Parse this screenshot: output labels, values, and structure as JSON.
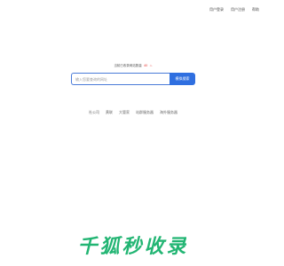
{
  "top_nav": {
    "items": [
      {
        "label": "用户登录"
      },
      {
        "label": "用户注册"
      },
      {
        "label": "帮助"
      }
    ]
  },
  "notice": {
    "text": "当前已收录网站数量",
    "count": "40",
    "icon": "fire-icon"
  },
  "search": {
    "placeholder": "输入您要查询的网址",
    "button_label": "模拟搜索"
  },
  "quick_links": [
    {
      "label": "社公司"
    },
    {
      "label": "黄联"
    },
    {
      "label": "大管家"
    },
    {
      "label": "站群服务器"
    },
    {
      "label": "海外服务器"
    }
  ],
  "logo": {
    "text": "千狐秒收录",
    "color": "#22b573"
  }
}
